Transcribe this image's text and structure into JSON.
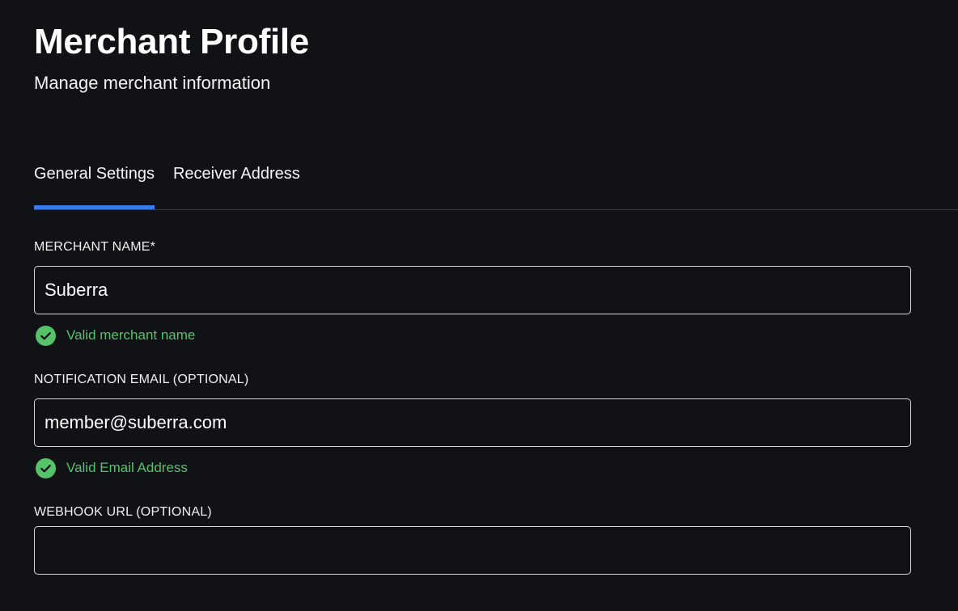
{
  "header": {
    "title": "Merchant Profile",
    "subtitle": "Manage merchant information"
  },
  "tabs": [
    {
      "label": "General Settings",
      "active": true
    },
    {
      "label": "Receiver Address",
      "active": false
    }
  ],
  "form": {
    "merchant_name": {
      "label": "MERCHANT NAME*",
      "value": "Suberra",
      "validation": "Valid merchant name"
    },
    "notification_email": {
      "label": "NOTIFICATION EMAIL (OPTIONAL)",
      "value": "member@suberra.com",
      "validation": "Valid Email Address"
    },
    "webhook_url": {
      "label": "WEBHOOK URL (OPTIONAL)",
      "value": ""
    }
  },
  "colors": {
    "background": "#111215",
    "accent": "#3b7ae8",
    "success": "#56c26a"
  },
  "icons": {
    "validation": "check-circle-icon"
  }
}
